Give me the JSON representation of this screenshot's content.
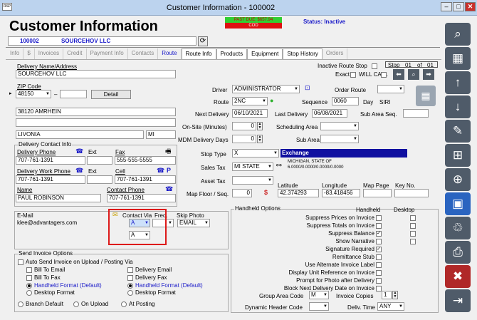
{
  "window": {
    "title": "Customer Information - 100002",
    "minimize": "‒",
    "maximize": "□",
    "close": "✕",
    "app_icon": "RSP"
  },
  "banner": {
    "past_due": "PAST DUE: $657.94",
    "cod": "COD",
    "status": "Status: Inactive"
  },
  "header": {
    "title": "Customer Information",
    "customer_id": "100002",
    "customer_name": "SOURCEHOV LLC"
  },
  "tabs": [
    "Info",
    "$",
    "Invoices",
    "Credit",
    "Payment Info",
    "Contacts",
    "Route",
    "Route Info",
    "Products",
    "Equipment",
    "Stop History",
    "Orders"
  ],
  "delivery": {
    "name_label": "Delivery Name/Address",
    "name": "SOURCEHOV LLC",
    "zip_label": "ZIP Code",
    "zip": "48150",
    "zip_dash": "–",
    "detail_button": "Detail",
    "address1": "38120 AMRHEIN",
    "address2": "",
    "city": "LIVONIA",
    "state": "MI"
  },
  "contact": {
    "group_label": "Delivery Contact Info",
    "phone_label": "Delivery Phone",
    "phone": "707-761-1391",
    "ext_label": "Ext",
    "fax_label": "Fax",
    "fax": "555-555-5555",
    "work_phone_label": "Delivery Work Phone",
    "work_phone": "707-761-1391",
    "cell_label": "Cell",
    "cell": "707-761-1391",
    "name_label": "Name",
    "name": "PAUL ROBINSON",
    "contact_phone_label": "Contact Phone",
    "contact_phone": "707-761-1391"
  },
  "email": {
    "label": "E-Mail",
    "value": "klee@advantagers.com",
    "contact_via_label": "Contact Via",
    "freq_label": "Freq.",
    "skip_photo_label": "Skip Photo",
    "contact_via_1": "A",
    "contact_via_2": "A",
    "freq": "",
    "skip_photo": "EMAIL"
  },
  "send_invoice": {
    "group_label": "Send Invoice Options",
    "auto_send": "Auto Send Invoice on Upload / Posting Via",
    "bill_to_email": "Bill To Email",
    "bill_to_fax": "Bill To Fax",
    "handheld_format": "Handheld Format (Default)",
    "desktop_format": "Desktop Format",
    "delivery_email": "Delivery Email",
    "delivery_fax": "Delivery Fax",
    "handheld_format_2": "Handheld Format (Default)",
    "desktop_format_2": "Desktop Format",
    "branch_default": "Branch Default",
    "on_upload": "On Upload",
    "at_posting": "At Posting"
  },
  "route": {
    "inactive_stop_label": "Inactive Route Stop",
    "exact_label": "Exact",
    "will_call_label": "WILL CALL",
    "stop_label": "Stop",
    "stop_num": "01",
    "of_label": "of",
    "stop_total": "01",
    "driver_label": "Driver",
    "driver": "ADMINISTRATOR",
    "order_route_label": "Order Route",
    "route_label": "Route",
    "route": "2NC",
    "sequence_label": "Sequence",
    "sequence": "0060",
    "day_label": "Day",
    "day": "SIRI",
    "next_delivery_label": "Next Delivery",
    "next_delivery": "06/10/2021",
    "last_delivery_label": "Last Delivery",
    "last_delivery": "06/08/2021",
    "sub_area_seq_label": "Sub Area Seq.",
    "onsite_label": "On-Site (Minutes)",
    "onsite": "0",
    "scheduling_area_label": "Scheduling Area",
    "mdm_label": "MDM Delivery Days",
    "mdm": "0",
    "sub_area_label": "Sub Area",
    "stop_type_label": "Stop Type",
    "stop_type": "X",
    "stop_type_desc": "Exchange",
    "sales_tax_label": "Sales Tax",
    "sales_tax": "MI STATE",
    "tax_desc_1": "MICHIGAN, STATE OF",
    "tax_desc_2": "6.0000/0.0000/0.0000/0.0000",
    "asset_tax_label": "Asset Tax",
    "latitude_label": "Latitude",
    "longitude_label": "Longitude",
    "map_page_label": "Map Page",
    "key_no_label": "Key No.",
    "map_floor_label": "Map Floor / Seq.",
    "map_floor": "0",
    "latitude": "42.374293",
    "longitude": "-83.418456"
  },
  "handheld": {
    "group_label": "Handheld Options",
    "col_handheld": "Handheld",
    "col_desktop": "Desktop",
    "options": [
      "Suppress Prices on Invoice",
      "Suppress Totals on Invoice",
      "Suppress Balance",
      "Show Narrative",
      "Signature Required",
      "Remittance Stub",
      "Use Alternate Invoice Label",
      "Display Unit Reference on Invoice",
      "Prompt for Photo after Delivery",
      "Block Next Delivery Date on Invoice"
    ],
    "group_area_label": "Group Area Code",
    "group_area": "M",
    "invoice_copies_label": "Invoice Copies",
    "invoice_copies": "1",
    "dynamic_header_label": "Dynamic Header Code",
    "deliv_time_label": "Deliv. Time",
    "deliv_time": "ANY"
  },
  "sidebar": [
    "search-icon",
    "grid-icon",
    "up-arrow-icon",
    "down-arrow-icon",
    "pencil-icon",
    "add-page-icon",
    "save-add-icon",
    "save-icon",
    "trash-icon",
    "print-icon",
    "close-x-icon",
    "exit-icon"
  ],
  "colors": {
    "title_bg": "#bcd3ee",
    "accent_blue": "#1818c8",
    "past_due_bg": "#32ce32",
    "cod_bg": "#dd1111",
    "exchange_bg": "#1010a0",
    "highlight_box": "#dd1a1a"
  }
}
